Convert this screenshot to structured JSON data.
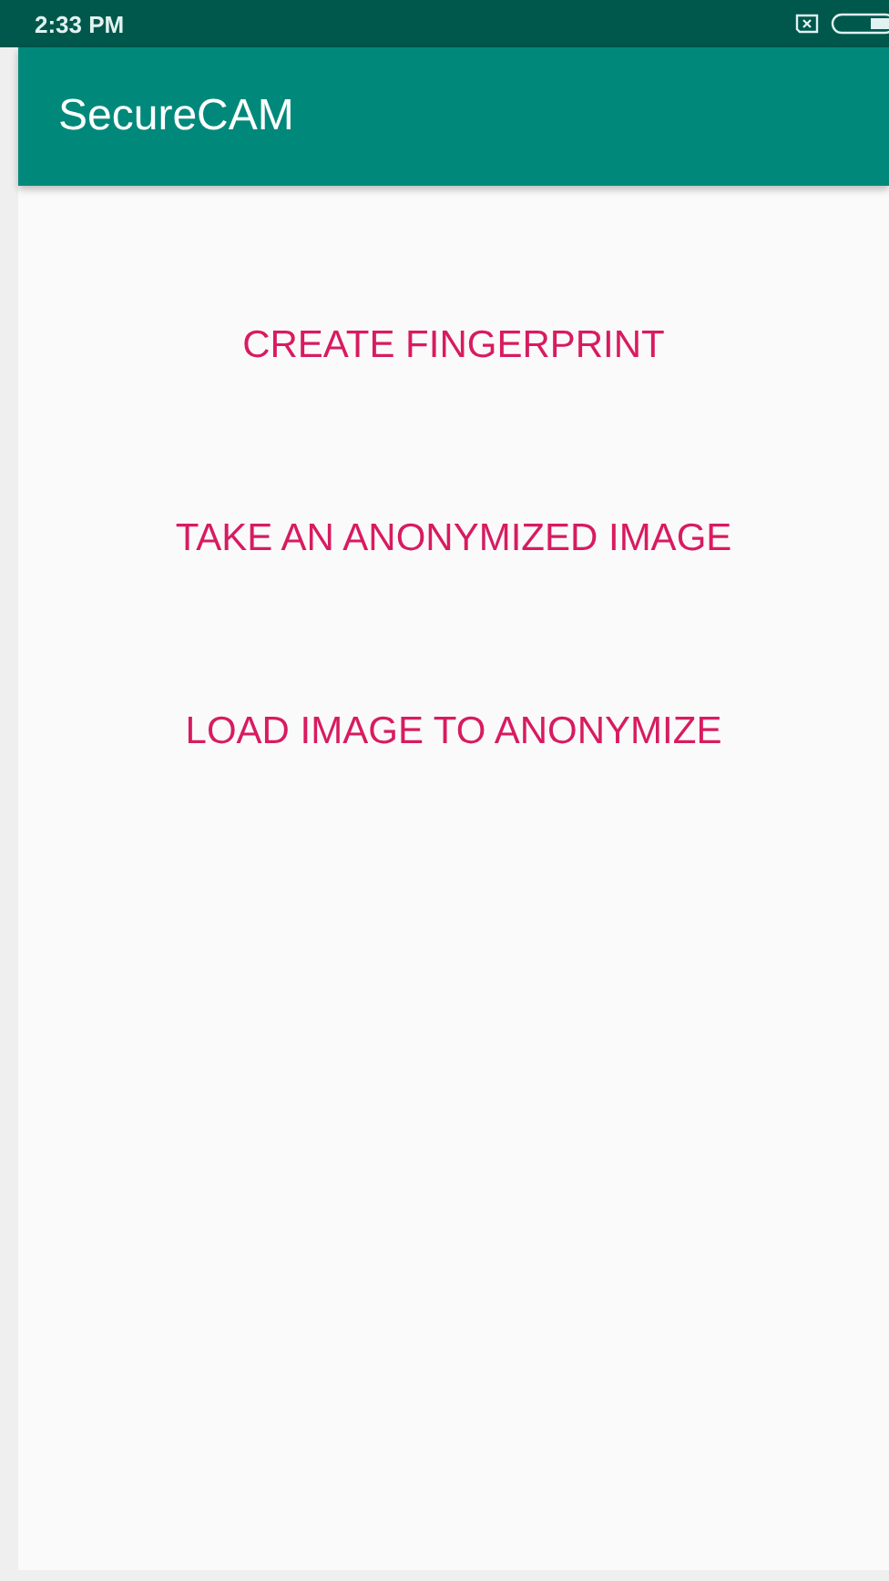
{
  "status_bar": {
    "time": "2:33 PM"
  },
  "app_bar": {
    "title": "SecureCAM"
  },
  "buttons": [
    {
      "label": "CREATE FINGERPRINT"
    },
    {
      "label": "TAKE AN ANONYMIZED IMAGE"
    },
    {
      "label": "LOAD IMAGE TO ANONYMIZE"
    }
  ]
}
